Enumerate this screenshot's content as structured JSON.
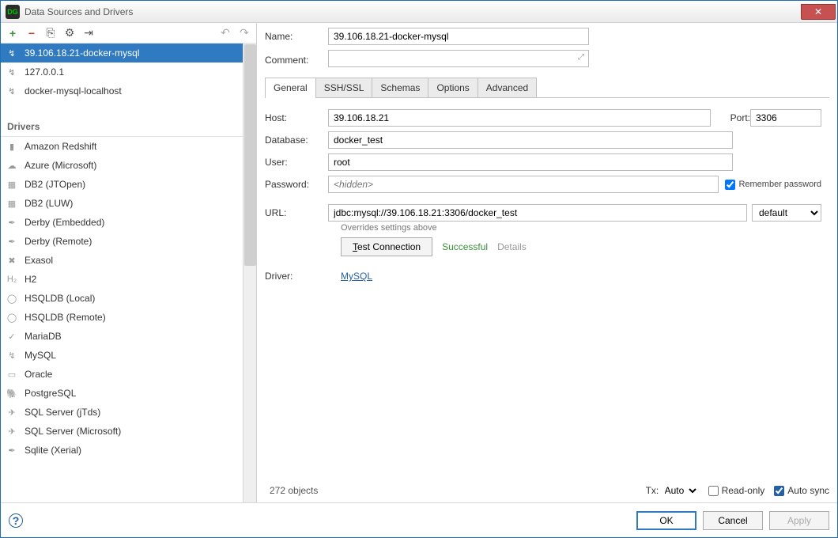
{
  "window": {
    "title": "Data Sources and Drivers",
    "app_icon_text": "DG"
  },
  "toolbar": {
    "tooltip_new": "+",
    "tooltip_del": "−",
    "tooltip_copy": "⎘",
    "tooltip_settings": "⚙",
    "tooltip_import": "⇥",
    "nav_back": "↶",
    "nav_fwd": "↷"
  },
  "datasources": [
    {
      "label": "39.106.18.21-docker-mysql",
      "selected": true
    },
    {
      "label": "127.0.0.1"
    },
    {
      "label": "docker-mysql-localhost"
    }
  ],
  "drivers_header": "Drivers",
  "drivers": [
    "Amazon Redshift",
    "Azure (Microsoft)",
    "DB2 (JTOpen)",
    "DB2 (LUW)",
    "Derby (Embedded)",
    "Derby (Remote)",
    "Exasol",
    "H2",
    "HSQLDB (Local)",
    "HSQLDB (Remote)",
    "MariaDB",
    "MySQL",
    "Oracle",
    "PostgreSQL",
    "SQL Server (jTds)",
    "SQL Server (Microsoft)",
    "Sqlite (Xerial)"
  ],
  "labels": {
    "name": "Name:",
    "comment": "Comment:",
    "host": "Host:",
    "port": "Port:",
    "database": "Database:",
    "user": "User:",
    "password": "Password:",
    "url": "URL:",
    "driver": "Driver:",
    "overrides": "Overrides settings above",
    "test": "Test Connection",
    "tx": "Tx:",
    "readonly": "Read-only",
    "autosync": "Auto sync",
    "remember": "Remember password",
    "status": "Successful",
    "details": "Details",
    "objects": "272 objects"
  },
  "tabs": [
    "General",
    "SSH/SSL",
    "Schemas",
    "Options",
    "Advanced"
  ],
  "active_tab": 0,
  "form": {
    "name": "39.106.18.21-docker-mysql",
    "host": "39.106.18.21",
    "port": "3306",
    "database": "docker_test",
    "user": "root",
    "password_placeholder": "<hidden>",
    "url": "jdbc:mysql://39.106.18.21:3306/docker_test",
    "url_mode": "default",
    "remember_password": true,
    "driver_name": "MySQL",
    "tx_mode": "Auto",
    "readonly": false,
    "autosync": true
  },
  "footer": {
    "ok": "OK",
    "cancel": "Cancel",
    "apply": "Apply"
  }
}
